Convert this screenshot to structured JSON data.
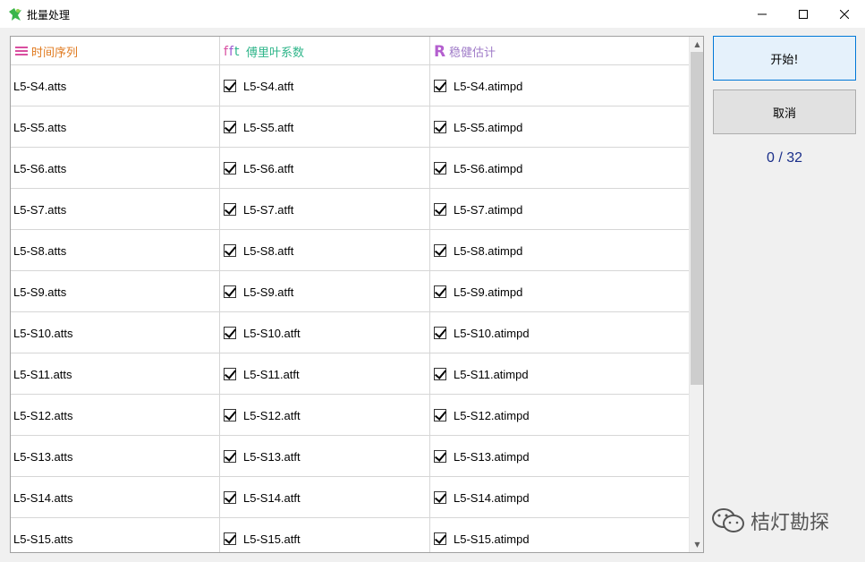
{
  "window": {
    "title": "批量处理"
  },
  "columns": [
    {
      "label": "时间序列",
      "color": "#e07a1f",
      "icon": "list-icon"
    },
    {
      "label": "傅里叶系数",
      "color": "#2fb58a",
      "icon": "fft-icon"
    },
    {
      "label": "稳健估计",
      "color": "#a07cc8",
      "icon": "r-icon"
    }
  ],
  "rows": [
    {
      "ts": "L5-S4.atts",
      "ft": "L5-S4.atft",
      "rb": "L5-S4.atimpd",
      "ft_checked": true,
      "rb_checked": true
    },
    {
      "ts": "L5-S5.atts",
      "ft": "L5-S5.atft",
      "rb": "L5-S5.atimpd",
      "ft_checked": true,
      "rb_checked": true
    },
    {
      "ts": "L5-S6.atts",
      "ft": "L5-S6.atft",
      "rb": "L5-S6.atimpd",
      "ft_checked": true,
      "rb_checked": true
    },
    {
      "ts": "L5-S7.atts",
      "ft": "L5-S7.atft",
      "rb": "L5-S7.atimpd",
      "ft_checked": true,
      "rb_checked": true
    },
    {
      "ts": "L5-S8.atts",
      "ft": "L5-S8.atft",
      "rb": "L5-S8.atimpd",
      "ft_checked": true,
      "rb_checked": true
    },
    {
      "ts": "L5-S9.atts",
      "ft": "L5-S9.atft",
      "rb": "L5-S9.atimpd",
      "ft_checked": true,
      "rb_checked": true
    },
    {
      "ts": "L5-S10.atts",
      "ft": "L5-S10.atft",
      "rb": "L5-S10.atimpd",
      "ft_checked": true,
      "rb_checked": true
    },
    {
      "ts": "L5-S11.atts",
      "ft": "L5-S11.atft",
      "rb": "L5-S11.atimpd",
      "ft_checked": true,
      "rb_checked": true
    },
    {
      "ts": "L5-S12.atts",
      "ft": "L5-S12.atft",
      "rb": "L5-S12.atimpd",
      "ft_checked": true,
      "rb_checked": true
    },
    {
      "ts": "L5-S13.atts",
      "ft": "L5-S13.atft",
      "rb": "L5-S13.atimpd",
      "ft_checked": true,
      "rb_checked": true
    },
    {
      "ts": "L5-S14.atts",
      "ft": "L5-S14.atft",
      "rb": "L5-S14.atimpd",
      "ft_checked": true,
      "rb_checked": true
    },
    {
      "ts": "L5-S15.atts",
      "ft": "L5-S15.atft",
      "rb": "L5-S15.atimpd",
      "ft_checked": true,
      "rb_checked": true
    }
  ],
  "buttons": {
    "start": "开始!",
    "cancel": "取消"
  },
  "progress": "0 / 32",
  "watermark": "桔灯勘探",
  "colors": {
    "progress": "#1a2f8a",
    "accent": "#0078d7"
  }
}
